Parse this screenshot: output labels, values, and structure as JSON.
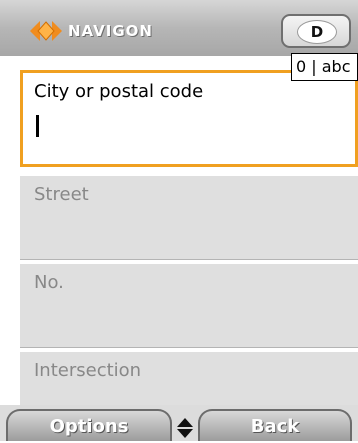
{
  "header": {
    "brand": "NAVIGON",
    "country_code": "D",
    "input_mode": "0 | abc"
  },
  "form": {
    "fields": [
      {
        "label": "City or postal code",
        "value": "",
        "active": true
      },
      {
        "label": "Street",
        "value": "",
        "active": false
      },
      {
        "label": "No.",
        "value": "",
        "active": false
      },
      {
        "label": "Intersection",
        "value": "",
        "active": false
      }
    ]
  },
  "softkeys": {
    "left": "Options",
    "right": "Back"
  },
  "colors": {
    "accent_focus": "#f0a020",
    "logo_orange": "#f08c1e",
    "field_bg": "#dfdfdf"
  }
}
